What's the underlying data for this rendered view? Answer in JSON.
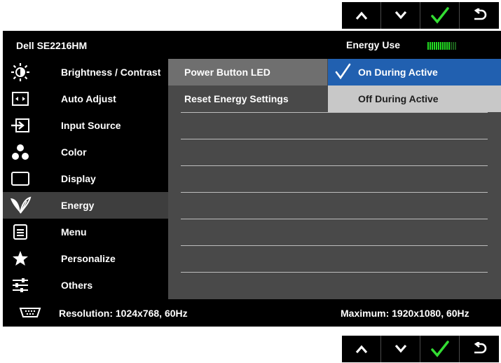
{
  "buttons": {
    "up": "up-arrow-icon",
    "down": "down-arrow-icon",
    "ok": "check-icon",
    "back": "back-arrow-icon"
  },
  "header": {
    "model": "Dell SE2216HM",
    "energy_use_label": "Energy Use",
    "energy_meter": {
      "segments_total": 14,
      "segments_lit": 11
    }
  },
  "menu": {
    "items": [
      {
        "label": "Brightness / Contrast",
        "icon": "brightness-icon"
      },
      {
        "label": "Auto Adjust",
        "icon": "auto-adjust-icon"
      },
      {
        "label": "Input Source",
        "icon": "input-source-icon"
      },
      {
        "label": "Color",
        "icon": "color-icon"
      },
      {
        "label": "Display",
        "icon": "display-icon"
      },
      {
        "label": "Energy",
        "icon": "energy-leaf-icon",
        "active": true
      },
      {
        "label": "Menu",
        "icon": "menu-icon"
      },
      {
        "label": "Personalize",
        "icon": "star-icon"
      },
      {
        "label": "Others",
        "icon": "sliders-icon"
      }
    ]
  },
  "submenu": {
    "items": [
      {
        "label": "Power Button LED",
        "selected": true
      },
      {
        "label": "Reset Energy Settings",
        "selected": false
      }
    ],
    "options": [
      {
        "label": "On During Active",
        "selected": true
      },
      {
        "label": "Off During Active",
        "selected": false
      }
    ]
  },
  "status": {
    "connector_icon": "vga-connector-icon",
    "resolution": "Resolution: 1024x768, 60Hz",
    "maximum": "Maximum: 1920x1080, 60Hz"
  },
  "colors": {
    "osd_background": "#000000",
    "content_panel": "#494949",
    "selection_blue": "#2160b0",
    "meter_green": "#22dd22"
  }
}
